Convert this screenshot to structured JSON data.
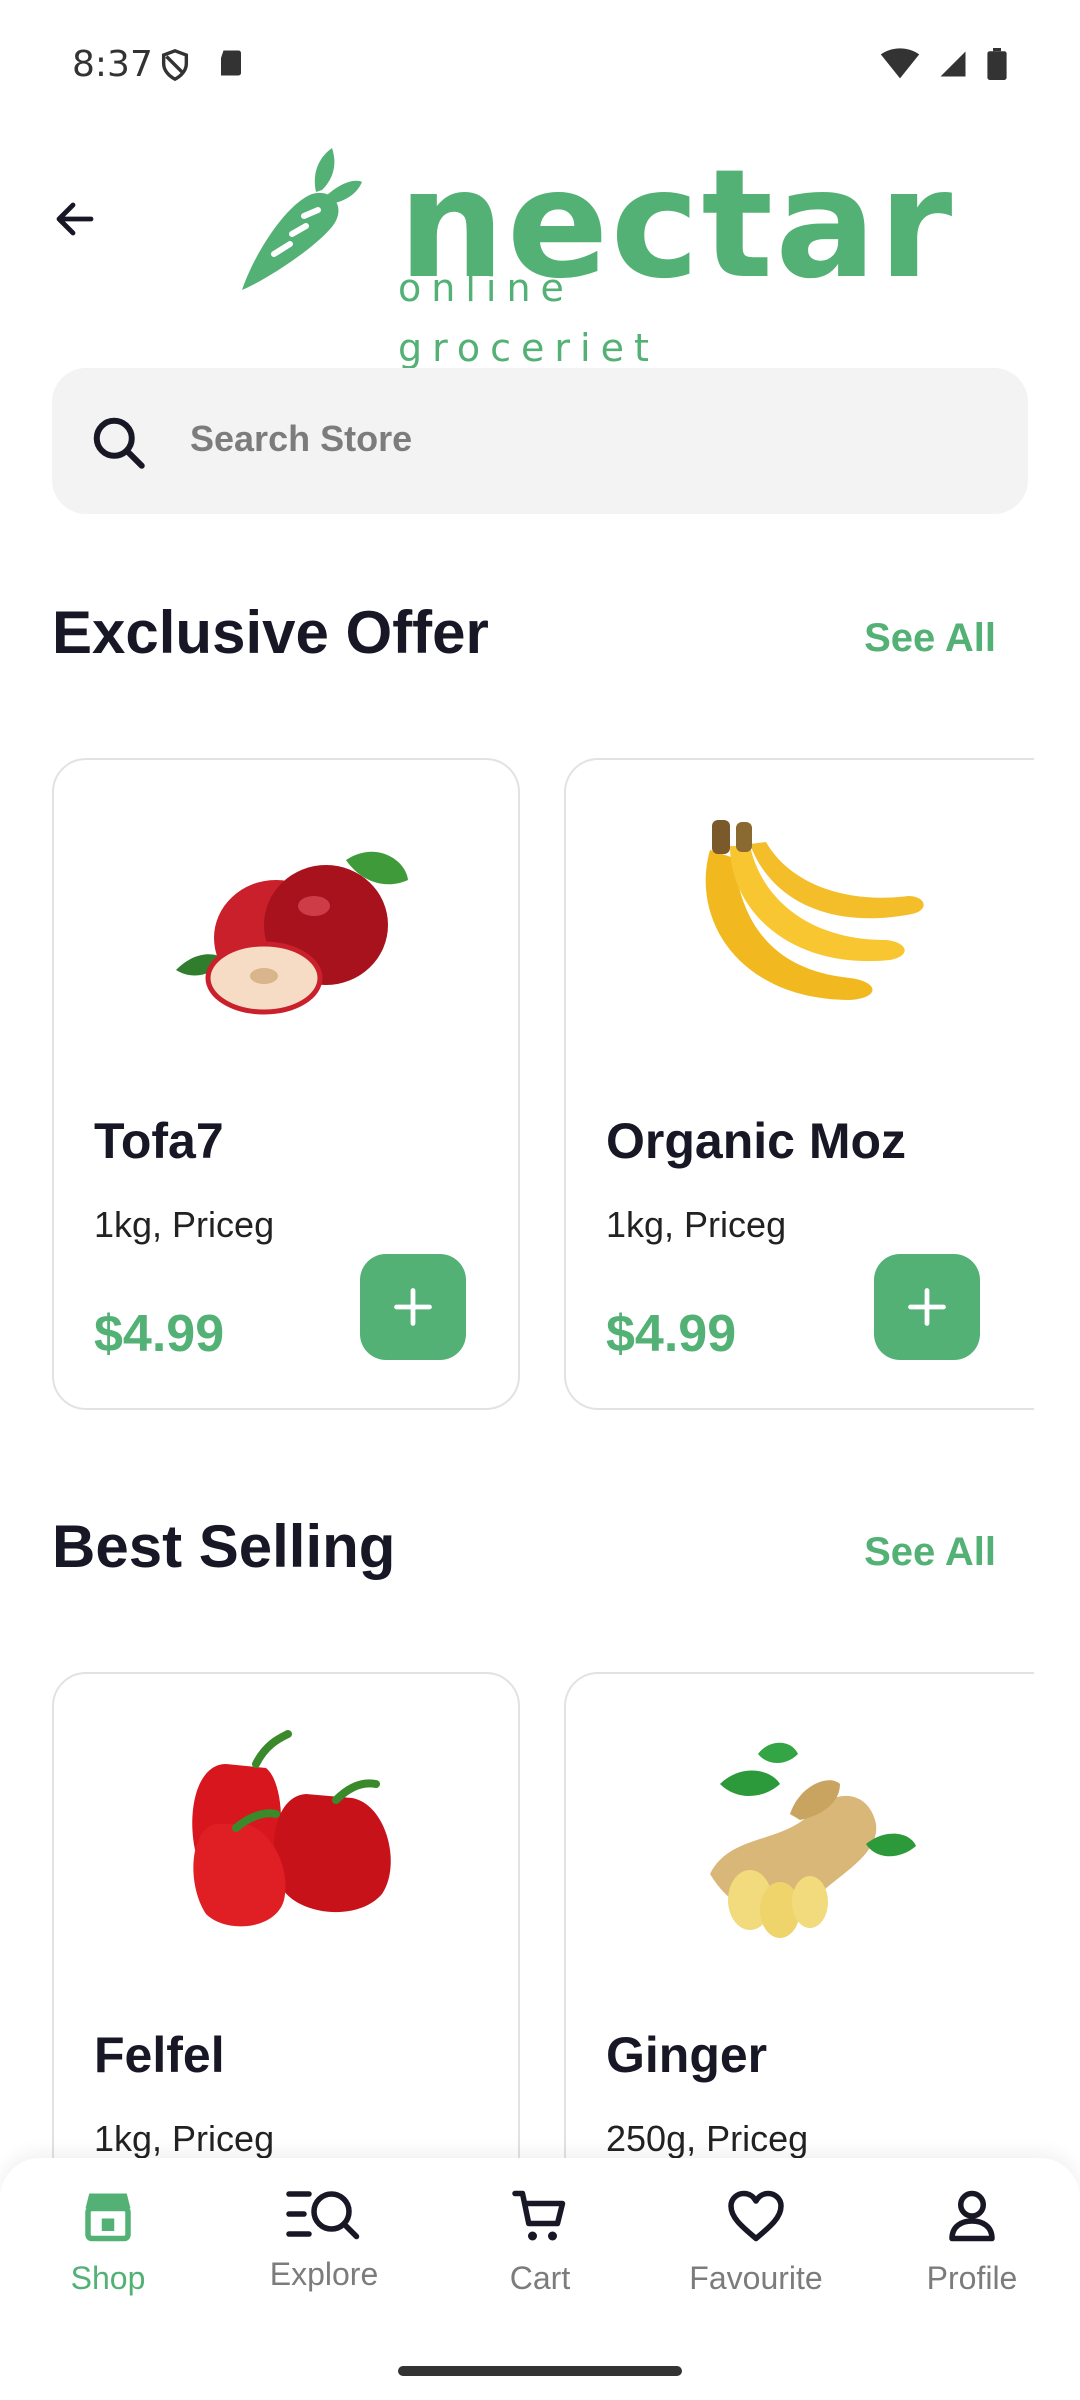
{
  "status": {
    "time": "8:37"
  },
  "header": {
    "logo_word": "nectar",
    "logo_sub": "online groceriet"
  },
  "search": {
    "placeholder": "Search Store"
  },
  "sections": {
    "exclusive": {
      "title": "Exclusive Offer",
      "see_all": "See All"
    },
    "best": {
      "title": "Best Selling",
      "see_all": "See All"
    }
  },
  "exclusive_products": [
    {
      "name": "Tofa7",
      "sub": "1kg, Priceg",
      "price": "$4.99",
      "icon": "apple-image"
    },
    {
      "name": "Organic Moz",
      "sub": "1kg, Priceg",
      "price": "$4.99",
      "icon": "banana-image"
    }
  ],
  "best_products": [
    {
      "name": "Felfel",
      "sub": "1kg, Priceg",
      "icon": "pepper-image"
    },
    {
      "name": "Ginger",
      "sub": "250g, Priceg",
      "icon": "ginger-image"
    }
  ],
  "nav": [
    {
      "label": "Shop",
      "icon": "store-icon",
      "active": true
    },
    {
      "label": "Explore",
      "icon": "explore-icon",
      "active": false
    },
    {
      "label": "Cart",
      "icon": "cart-icon",
      "active": false
    },
    {
      "label": "Favourite",
      "icon": "heart-icon",
      "active": false
    },
    {
      "label": "Profile",
      "icon": "person-icon",
      "active": false
    }
  ],
  "colors": {
    "accent": "#53B175",
    "text": "#181725",
    "muted": "#7C7C7C",
    "search_bg": "#F2F3F2"
  }
}
